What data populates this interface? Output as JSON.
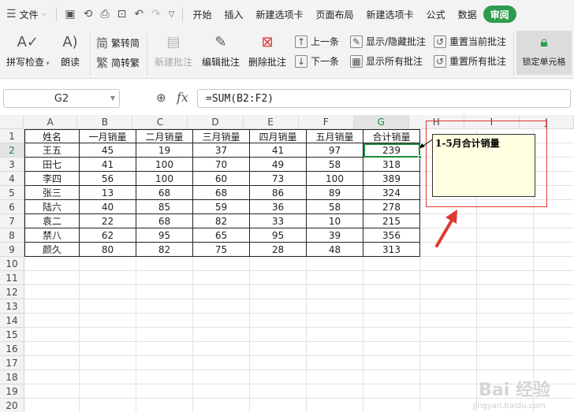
{
  "menubar": {
    "file": "文件",
    "tabs": [
      "开始",
      "插入",
      "新建选项卡",
      "页面布局",
      "新建选项卡",
      "公式",
      "数据",
      "审阅"
    ],
    "active_tab": "审阅"
  },
  "ribbon": {
    "spellcheck": "拼写检查",
    "read_aloud": "朗读",
    "to_traditional": "繁转简",
    "to_simplified": "简转繁",
    "new_comment": "新建批注",
    "edit_comment": "编辑批注",
    "delete_comment": "删除批注",
    "prev": "上一条",
    "next": "下一条",
    "show_hide": "显示/隐藏批注",
    "show_all": "显示所有批注",
    "reset_current": "重置当前批注",
    "reset_all": "重置所有批注",
    "lock_cell": "锁定单元格"
  },
  "formula_bar": {
    "name_box": "G2",
    "fx": "fx",
    "formula": "=SUM(B2:F2)"
  },
  "sheet": {
    "columns": [
      "A",
      "B",
      "C",
      "D",
      "E",
      "F",
      "G",
      "H",
      "I",
      "J"
    ],
    "row_numbers": [
      "1",
      "2",
      "3",
      "4",
      "5",
      "6",
      "7",
      "8",
      "9",
      "10",
      "11",
      "12",
      "13",
      "14",
      "15",
      "16",
      "17",
      "18",
      "19",
      "20"
    ],
    "headers": [
      "姓名",
      "一月销量",
      "二月销量",
      "三月销量",
      "四月销量",
      "五月销量",
      "合计销量"
    ],
    "rows": [
      [
        "王五",
        "45",
        "19",
        "37",
        "41",
        "97",
        "239"
      ],
      [
        "田七",
        "41",
        "100",
        "70",
        "49",
        "58",
        "318"
      ],
      [
        "李四",
        "56",
        "100",
        "60",
        "73",
        "100",
        "389"
      ],
      [
        "张三",
        "13",
        "68",
        "68",
        "86",
        "89",
        "324"
      ],
      [
        "陆六",
        "40",
        "85",
        "59",
        "36",
        "58",
        "278"
      ],
      [
        "袁二",
        "22",
        "68",
        "82",
        "33",
        "10",
        "215"
      ],
      [
        "禁八",
        "62",
        "95",
        "65",
        "95",
        "39",
        "356"
      ],
      [
        "颜久",
        "80",
        "82",
        "75",
        "28",
        "48",
        "313"
      ]
    ],
    "selected_cell": "G2",
    "comment": "1-5月合计销量"
  },
  "watermark": {
    "brand": "Bai 经验",
    "sub": "jingyan.baidu.com"
  },
  "colors": {
    "accent": "#2e9c4e",
    "selection": "#1e8a3e",
    "annotation": "#e0392d",
    "comment_bg": "#ffffe1"
  }
}
